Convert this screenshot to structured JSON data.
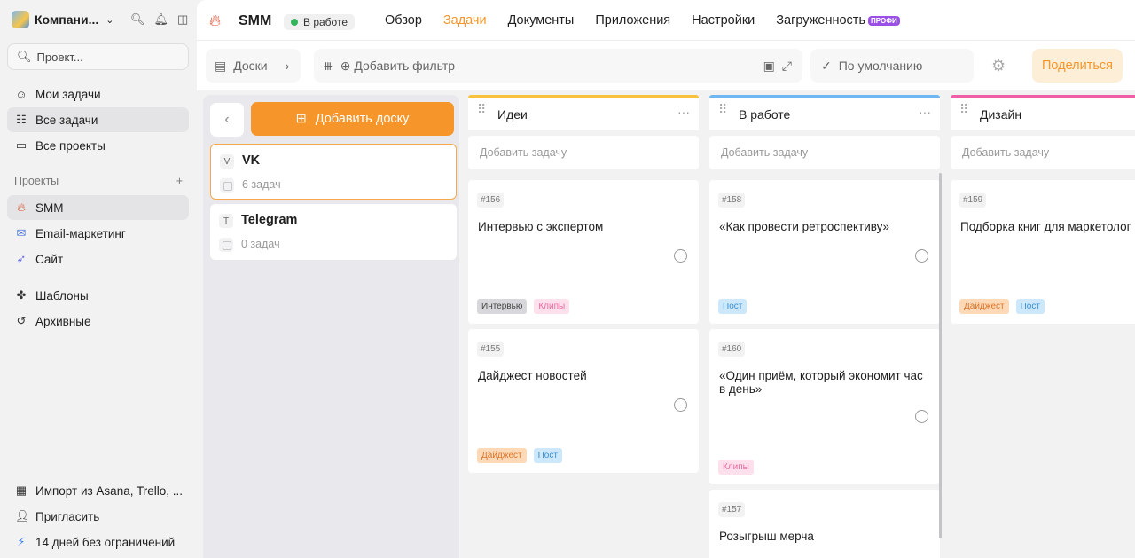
{
  "workspace": {
    "name": "Компани...",
    "logo_icon": "workspace-logo"
  },
  "search": {
    "placeholder": "Проект..."
  },
  "nav": [
    {
      "label": "Мои задачи",
      "icon": "smiley-icon"
    },
    {
      "label": "Все задачи",
      "icon": "tasks-icon"
    },
    {
      "label": "Все проекты",
      "icon": "folder-icon"
    }
  ],
  "projects": {
    "label": "Проекты",
    "items": [
      {
        "label": "SMM",
        "icon": "fire-icon"
      },
      {
        "label": "Email-маркетинг",
        "icon": "mail-icon"
      },
      {
        "label": "Сайт",
        "icon": "rocket-icon"
      }
    ]
  },
  "extra_nav": [
    {
      "label": "Шаблоны",
      "icon": "templates-icon"
    },
    {
      "label": "Архивные",
      "icon": "archive-icon"
    }
  ],
  "bottom_nav": [
    {
      "label": "Импорт из Asana, Trello, ...",
      "icon": "trello-icon"
    },
    {
      "label": "Пригласить",
      "icon": "invite-icon"
    },
    {
      "label": "14 дней без ограничений",
      "icon": "bolt-icon"
    }
  ],
  "header": {
    "project": "SMM",
    "status": "В работе",
    "tabs": [
      "Обзор",
      "Задачи",
      "Документы",
      "Приложения",
      "Настройки",
      "Загруженность"
    ],
    "active_tab": "Задачи",
    "badge": "ПРОФИ"
  },
  "toolbar": {
    "boards_label": "Доски",
    "filter_label": "Добавить фильтр",
    "sort_label": "По умолчанию",
    "share_label": "Поделиться"
  },
  "boards_panel": {
    "add_label": "Добавить доску",
    "boards": [
      {
        "letter": "V",
        "name": "VK",
        "count": "6 задач"
      },
      {
        "letter": "T",
        "name": "Telegram",
        "count": "0 задач"
      }
    ]
  },
  "columns": [
    {
      "title": "Идеи",
      "color": "#f9c23c",
      "add_label": "Добавить задачу",
      "cards": [
        {
          "id": "#156",
          "title": "Интервью с экспертом",
          "tags": [
            "Интервью",
            "Клипы"
          ]
        },
        {
          "id": "#155",
          "title": "Дайджест новостей",
          "tags": [
            "Дайджест",
            "Пост"
          ]
        }
      ]
    },
    {
      "title": "В работе",
      "color": "#6fb7f2",
      "add_label": "Добавить задачу",
      "cards": [
        {
          "id": "#158",
          "title": "«Как провести ретроспективу»",
          "tags": [
            "Пост"
          ]
        },
        {
          "id": "#160",
          "title": "«Один приём, который экономит час в день»",
          "tags": [
            "Клипы"
          ]
        },
        {
          "id": "#157",
          "title": "Розыгрыш мерча",
          "tags": []
        }
      ]
    },
    {
      "title": "Дизайн",
      "color": "#ef5fa7",
      "add_label": "Добавить задачу",
      "cards": [
        {
          "id": "#159",
          "title": "Подборка книг для маркетолог",
          "tags": [
            "Дайджест",
            "Пост"
          ]
        }
      ]
    }
  ],
  "tag_colors": {
    "Интервью": {
      "bg": "#d7d7dc",
      "fg": "#444444"
    },
    "Клипы": {
      "bg": "#fde0ec",
      "fg": "#e76aa0"
    },
    "Дайджест": {
      "bg": "#fdd9b8",
      "fg": "#d9762a"
    },
    "Пост": {
      "bg": "#cde8fb",
      "fg": "#3b8fd0"
    }
  }
}
